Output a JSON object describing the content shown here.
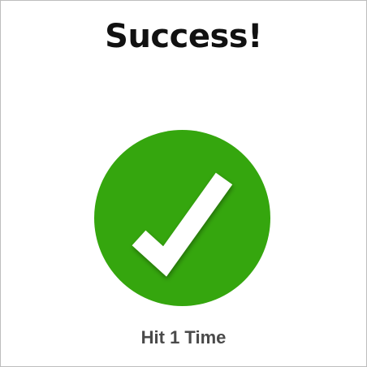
{
  "dialog": {
    "title": "Success!",
    "status_icon": "checkmark-icon",
    "accent_color": "#35a60e",
    "caption": "Hit 1 Time"
  }
}
